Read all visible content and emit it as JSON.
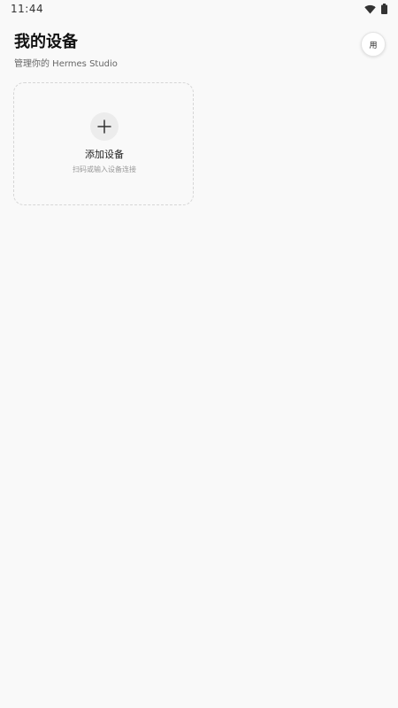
{
  "status_bar": {
    "time": "11:44",
    "icons": [
      "wifi-icon",
      "battery-icon"
    ]
  },
  "header": {
    "title": "我的设备",
    "subtitle": "管理你的 Hermes Studio",
    "avatar_label": "用"
  },
  "add_device_card": {
    "icon": "plus-icon",
    "label": "添加设备",
    "hint": "扫码或输入设备连接"
  },
  "colors": {
    "background": "#f9f9f9",
    "card_border": "#d6d6d6",
    "icon_circle": "#ececec",
    "text_primary": "#111111",
    "text_secondary": "#666666",
    "text_hint": "#999999"
  }
}
